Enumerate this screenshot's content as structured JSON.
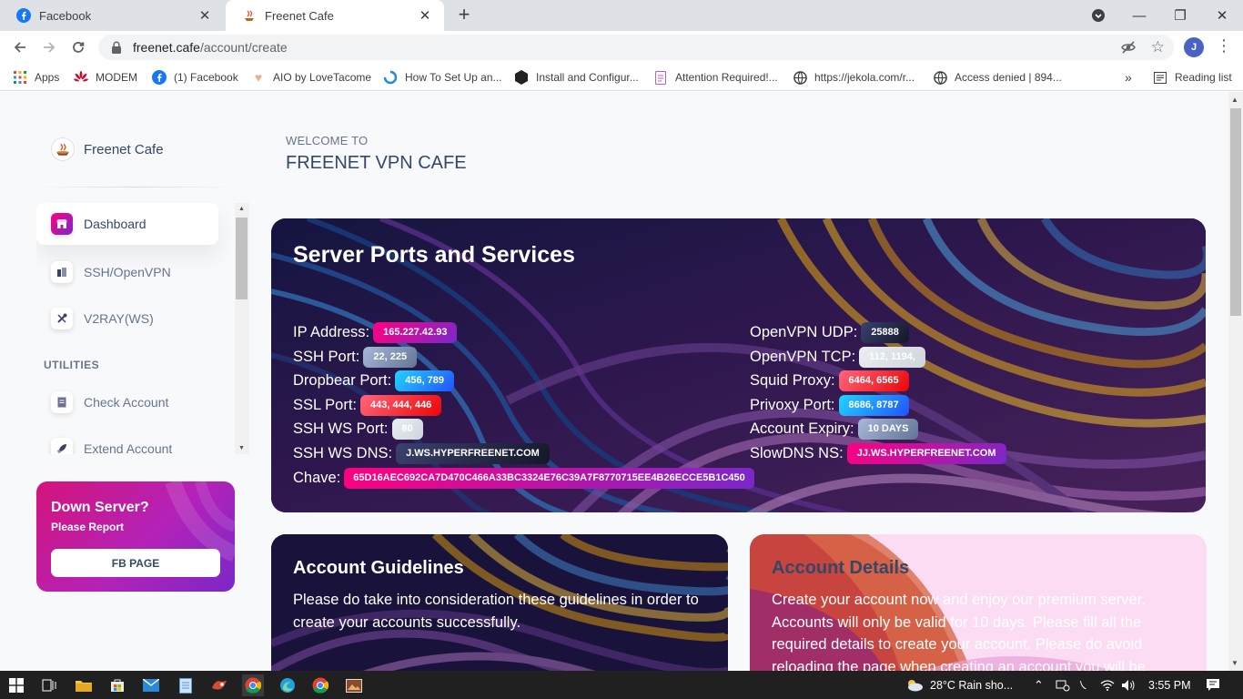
{
  "browser": {
    "tabs": [
      {
        "label": "Facebook",
        "icon": "facebook-icon",
        "active": false
      },
      {
        "label": "Freenet Cafe",
        "icon": "cafe-favicon",
        "active": true
      }
    ],
    "url_host": "freenet.cafe",
    "url_path": "/account/create",
    "profile_initial": "J",
    "bookmarks": [
      {
        "label": "Apps",
        "icon": "apps-grid-icon"
      },
      {
        "label": "MODEM",
        "icon": "huawei-icon"
      },
      {
        "label": "(1) Facebook",
        "icon": "facebook-icon"
      },
      {
        "label": "AIO by LoveTacome",
        "icon": "heart-icon"
      },
      {
        "label": "How To Set Up an...",
        "icon": "spinner-icon"
      },
      {
        "label": "Install and Configur...",
        "icon": "hexagon-icon"
      },
      {
        "label": "Attention Required!...",
        "icon": "document-icon"
      },
      {
        "label": "https://jekola.com/r...",
        "icon": "globe-icon"
      },
      {
        "label": "Access denied | 894...",
        "icon": "globe-icon"
      }
    ],
    "bookmarks_more": "»",
    "reading_list": "Reading list"
  },
  "sidebar": {
    "brand": "Freenet Cafe",
    "items": [
      {
        "label": "Dashboard",
        "icon": "shop-icon",
        "active": true
      },
      {
        "label": "SSH/OpenVPN",
        "icon": "office-icon",
        "active": false
      },
      {
        "label": "V2RAY(WS)",
        "icon": "tools-icon",
        "active": false
      }
    ],
    "section": "UTILITIES",
    "utilities": [
      {
        "label": "Check Account",
        "icon": "document-icon"
      },
      {
        "label": "Extend Account",
        "icon": "rocket-icon"
      }
    ],
    "report": {
      "title": "Down Server?",
      "subtitle": "Please Report",
      "button": "FB PAGE"
    }
  },
  "header": {
    "welcome": "WELCOME TO",
    "title": "FREENET VPN CAFE"
  },
  "server": {
    "title": "Server Ports and Services",
    "left": [
      {
        "label": "IP Address:",
        "value": "165.227.42.93",
        "color": "pink"
      },
      {
        "label": "SSH Port:",
        "value": "22, 225",
        "color": "grey"
      },
      {
        "label": "Dropbear Port:",
        "value": "456, 789",
        "color": "blue"
      },
      {
        "label": "SSL Port:",
        "value": "443, 444, 446",
        "color": "red"
      },
      {
        "label": "SSH WS Port:",
        "value": "80",
        "color": "light"
      },
      {
        "label": "SSH WS DNS:",
        "value": "J.WS.HYPERFREENET.COM",
        "color": "dark"
      },
      {
        "label": "Chave:",
        "value": "65D16AEC692CA7D470C466A33BC3324E76C39A7F8770715EE4B26ECCE5B1C450",
        "color": "pink"
      }
    ],
    "right": [
      {
        "label": "OpenVPN UDP:",
        "value": "25888",
        "color": "dark"
      },
      {
        "label": "OpenVPN TCP:",
        "value": "112, 1194,",
        "color": "light"
      },
      {
        "label": "Squid Proxy:",
        "value": "6464, 6565",
        "color": "red"
      },
      {
        "label": "Privoxy Port:",
        "value": "8686, 8787",
        "color": "blue"
      },
      {
        "label": "Account Expiry:",
        "value": "10 DAYS",
        "color": "grey"
      },
      {
        "label": "SlowDNS NS:",
        "value": "JJ.WS.HYPERFREENET.COM",
        "color": "pink"
      }
    ]
  },
  "guidelines": {
    "title": "Account Guidelines",
    "body": "Please do take into consideration these guidelines in order to create your accounts successfully."
  },
  "details": {
    "title": "Account Details",
    "body": "Create your account now and enjoy our premium server. Accounts will only be valid for 10 days. Please fill all the required details to create your account. Please do avoid reloading the page when creating an account you will be"
  },
  "taskbar": {
    "weather": "28°C  Rain sho...",
    "time": "3:55 PM"
  },
  "colors": {
    "accent_pink": "#ff0080",
    "accent_purple": "#7928ca",
    "text_dark": "#344767",
    "text_muted": "#67748e"
  }
}
